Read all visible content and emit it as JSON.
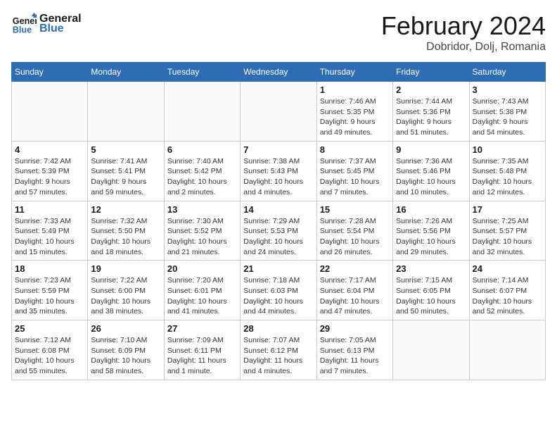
{
  "logo": {
    "general": "General",
    "blue": "Blue"
  },
  "header": {
    "month": "February 2024",
    "location": "Dobridor, Dolj, Romania"
  },
  "weekdays": [
    "Sunday",
    "Monday",
    "Tuesday",
    "Wednesday",
    "Thursday",
    "Friday",
    "Saturday"
  ],
  "weeks": [
    [
      {
        "day": "",
        "info": ""
      },
      {
        "day": "",
        "info": ""
      },
      {
        "day": "",
        "info": ""
      },
      {
        "day": "",
        "info": ""
      },
      {
        "day": "1",
        "info": "Sunrise: 7:46 AM\nSunset: 5:35 PM\nDaylight: 9 hours\nand 49 minutes."
      },
      {
        "day": "2",
        "info": "Sunrise: 7:44 AM\nSunset: 5:36 PM\nDaylight: 9 hours\nand 51 minutes."
      },
      {
        "day": "3",
        "info": "Sunrise: 7:43 AM\nSunset: 5:38 PM\nDaylight: 9 hours\nand 54 minutes."
      }
    ],
    [
      {
        "day": "4",
        "info": "Sunrise: 7:42 AM\nSunset: 5:39 PM\nDaylight: 9 hours\nand 57 minutes."
      },
      {
        "day": "5",
        "info": "Sunrise: 7:41 AM\nSunset: 5:41 PM\nDaylight: 9 hours\nand 59 minutes."
      },
      {
        "day": "6",
        "info": "Sunrise: 7:40 AM\nSunset: 5:42 PM\nDaylight: 10 hours\nand 2 minutes."
      },
      {
        "day": "7",
        "info": "Sunrise: 7:38 AM\nSunset: 5:43 PM\nDaylight: 10 hours\nand 4 minutes."
      },
      {
        "day": "8",
        "info": "Sunrise: 7:37 AM\nSunset: 5:45 PM\nDaylight: 10 hours\nand 7 minutes."
      },
      {
        "day": "9",
        "info": "Sunrise: 7:36 AM\nSunset: 5:46 PM\nDaylight: 10 hours\nand 10 minutes."
      },
      {
        "day": "10",
        "info": "Sunrise: 7:35 AM\nSunset: 5:48 PM\nDaylight: 10 hours\nand 12 minutes."
      }
    ],
    [
      {
        "day": "11",
        "info": "Sunrise: 7:33 AM\nSunset: 5:49 PM\nDaylight: 10 hours\nand 15 minutes."
      },
      {
        "day": "12",
        "info": "Sunrise: 7:32 AM\nSunset: 5:50 PM\nDaylight: 10 hours\nand 18 minutes."
      },
      {
        "day": "13",
        "info": "Sunrise: 7:30 AM\nSunset: 5:52 PM\nDaylight: 10 hours\nand 21 minutes."
      },
      {
        "day": "14",
        "info": "Sunrise: 7:29 AM\nSunset: 5:53 PM\nDaylight: 10 hours\nand 24 minutes."
      },
      {
        "day": "15",
        "info": "Sunrise: 7:28 AM\nSunset: 5:54 PM\nDaylight: 10 hours\nand 26 minutes."
      },
      {
        "day": "16",
        "info": "Sunrise: 7:26 AM\nSunset: 5:56 PM\nDaylight: 10 hours\nand 29 minutes."
      },
      {
        "day": "17",
        "info": "Sunrise: 7:25 AM\nSunset: 5:57 PM\nDaylight: 10 hours\nand 32 minutes."
      }
    ],
    [
      {
        "day": "18",
        "info": "Sunrise: 7:23 AM\nSunset: 5:59 PM\nDaylight: 10 hours\nand 35 minutes."
      },
      {
        "day": "19",
        "info": "Sunrise: 7:22 AM\nSunset: 6:00 PM\nDaylight: 10 hours\nand 38 minutes."
      },
      {
        "day": "20",
        "info": "Sunrise: 7:20 AM\nSunset: 6:01 PM\nDaylight: 10 hours\nand 41 minutes."
      },
      {
        "day": "21",
        "info": "Sunrise: 7:18 AM\nSunset: 6:03 PM\nDaylight: 10 hours\nand 44 minutes."
      },
      {
        "day": "22",
        "info": "Sunrise: 7:17 AM\nSunset: 6:04 PM\nDaylight: 10 hours\nand 47 minutes."
      },
      {
        "day": "23",
        "info": "Sunrise: 7:15 AM\nSunset: 6:05 PM\nDaylight: 10 hours\nand 50 minutes."
      },
      {
        "day": "24",
        "info": "Sunrise: 7:14 AM\nSunset: 6:07 PM\nDaylight: 10 hours\nand 52 minutes."
      }
    ],
    [
      {
        "day": "25",
        "info": "Sunrise: 7:12 AM\nSunset: 6:08 PM\nDaylight: 10 hours\nand 55 minutes."
      },
      {
        "day": "26",
        "info": "Sunrise: 7:10 AM\nSunset: 6:09 PM\nDaylight: 10 hours\nand 58 minutes."
      },
      {
        "day": "27",
        "info": "Sunrise: 7:09 AM\nSunset: 6:11 PM\nDaylight: 11 hours\nand 1 minute."
      },
      {
        "day": "28",
        "info": "Sunrise: 7:07 AM\nSunset: 6:12 PM\nDaylight: 11 hours\nand 4 minutes."
      },
      {
        "day": "29",
        "info": "Sunrise: 7:05 AM\nSunset: 6:13 PM\nDaylight: 11 hours\nand 7 minutes."
      },
      {
        "day": "",
        "info": ""
      },
      {
        "day": "",
        "info": ""
      }
    ]
  ]
}
